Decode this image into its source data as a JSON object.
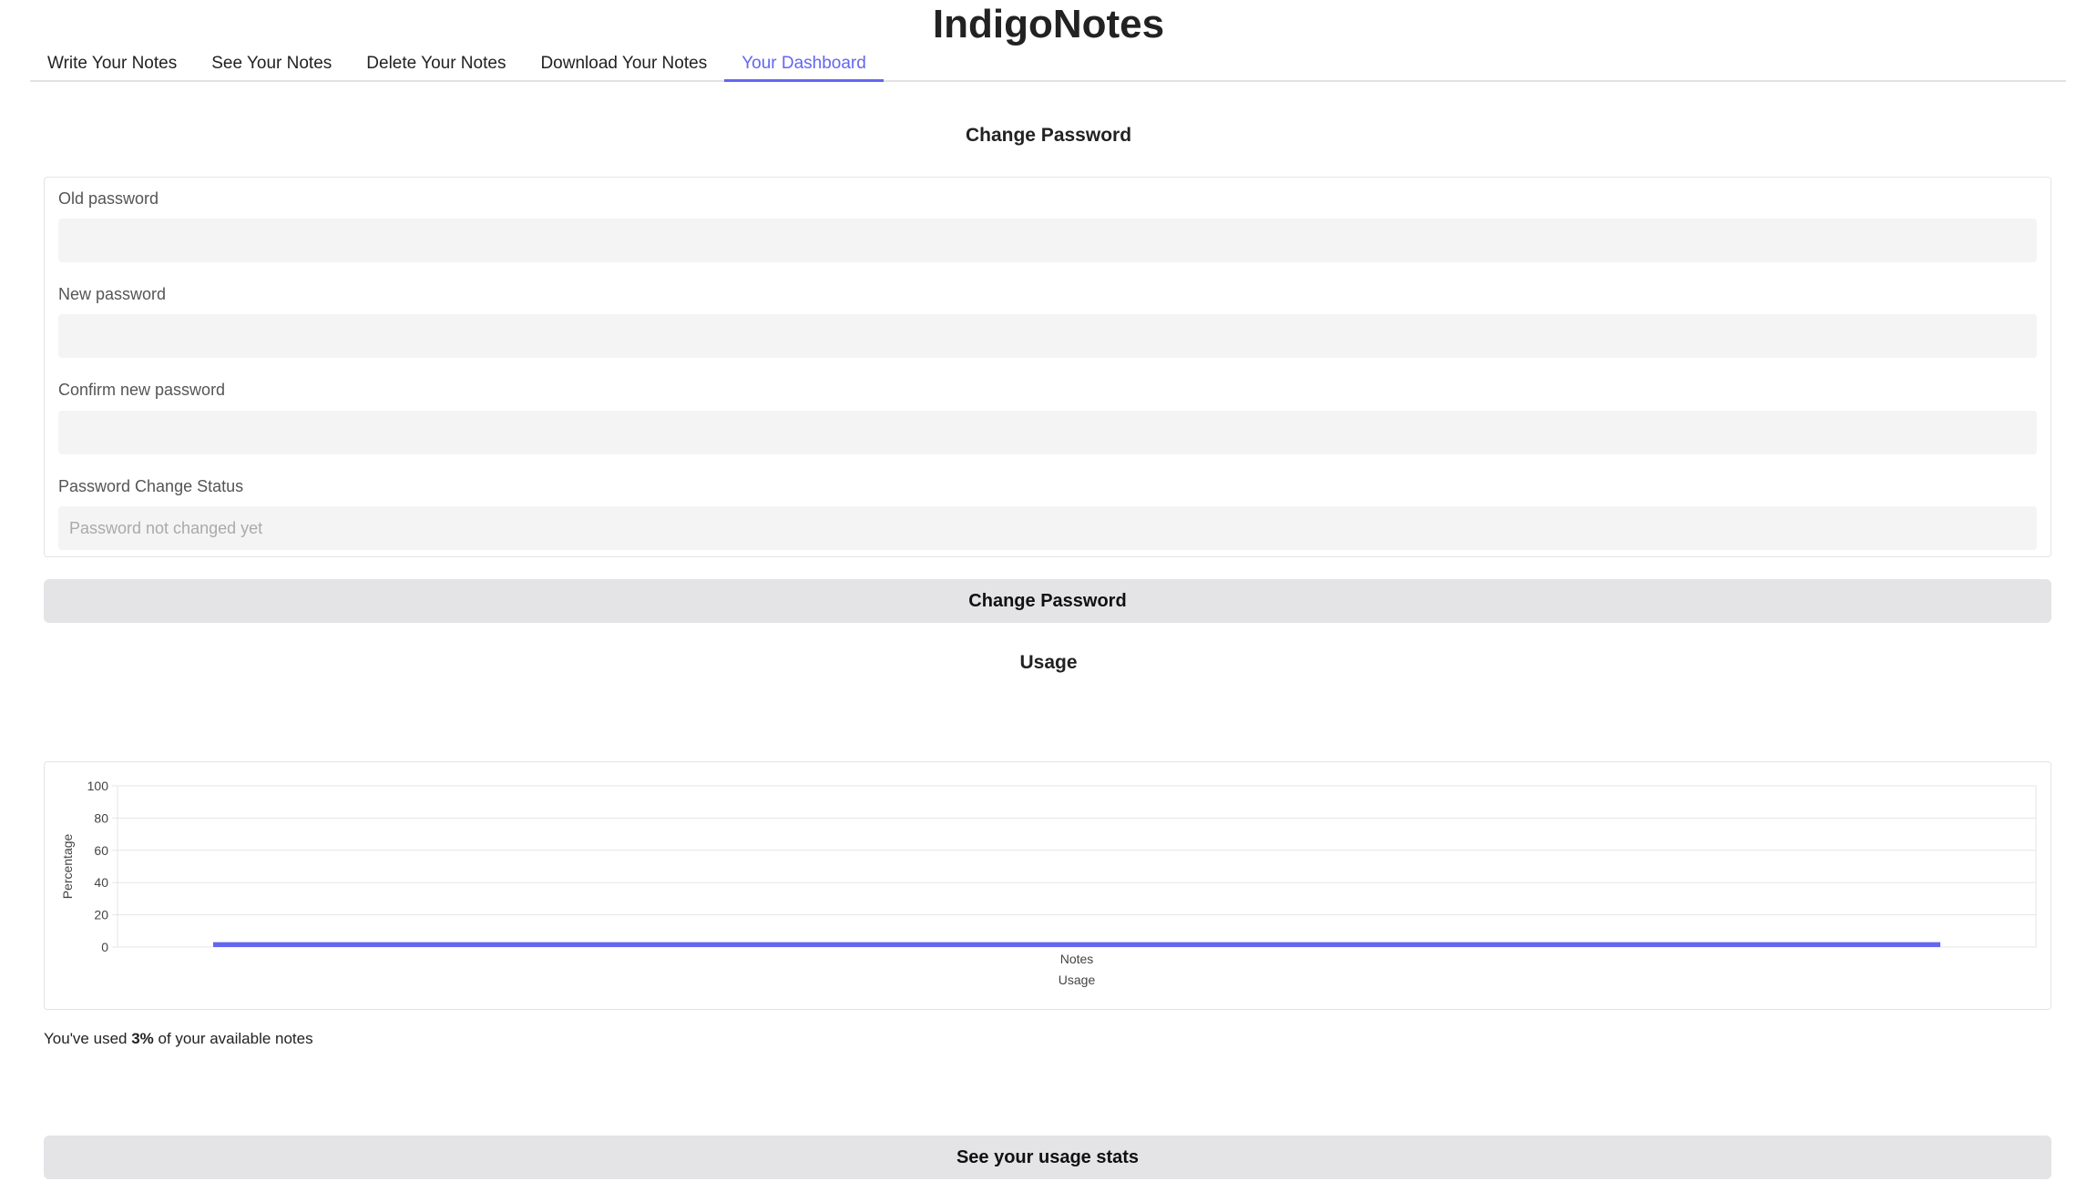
{
  "app": {
    "title": "IndigoNotes"
  },
  "tabs": [
    {
      "label": "Write Your Notes",
      "active": false
    },
    {
      "label": "See Your Notes",
      "active": false
    },
    {
      "label": "Delete Your Notes",
      "active": false
    },
    {
      "label": "Download Your Notes",
      "active": false
    },
    {
      "label": "Your Dashboard",
      "active": true
    }
  ],
  "change_password": {
    "heading": "Change Password",
    "old_password": {
      "label": "Old password",
      "value": "",
      "placeholder": ""
    },
    "new_password": {
      "label": "New password",
      "value": "",
      "placeholder": ""
    },
    "confirm_password": {
      "label": "Confirm new password",
      "value": "",
      "placeholder": ""
    },
    "status": {
      "label": "Password Change Status",
      "value": "",
      "placeholder": "Password not changed yet"
    },
    "button_label": "Change Password"
  },
  "usage": {
    "heading": "Usage",
    "sentence_prefix": "You've used ",
    "percent_text": "3%",
    "sentence_suffix": " of your available notes",
    "stats_button_label": "See your usage stats"
  },
  "colors": {
    "accent": "#6366f1",
    "button_bg": "#e4e4e7",
    "input_bg": "#f4f4f4"
  },
  "chart_data": {
    "type": "bar",
    "orientation": "horizontal",
    "categories": [
      "Usage"
    ],
    "series": [
      {
        "name": "Notes",
        "values": [
          3
        ]
      }
    ],
    "ylabel": "Percentage",
    "ylim": [
      0,
      100
    ],
    "yticks": [
      0,
      20,
      40,
      60,
      80,
      100
    ],
    "x_tick_label": "Notes",
    "xlabel": "Usage",
    "grid": true,
    "color": "#6366f1"
  }
}
